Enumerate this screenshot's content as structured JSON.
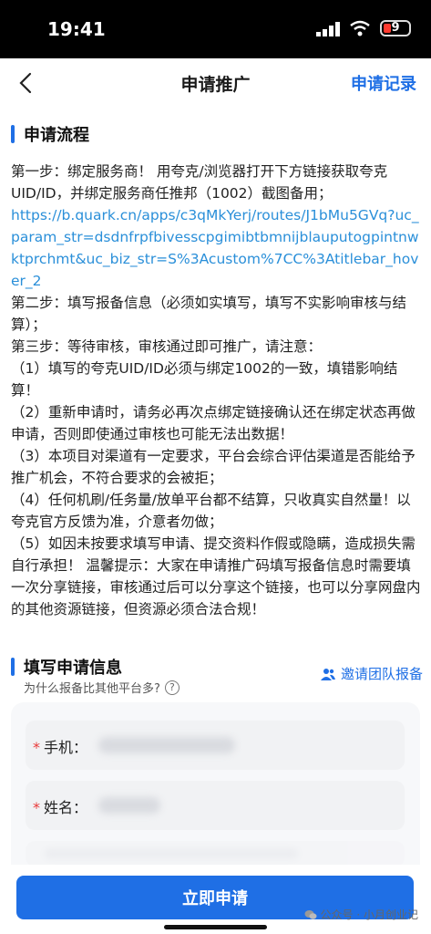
{
  "status": {
    "time": "19:41",
    "battery": "9",
    "colors": {
      "battery_low": "#ff3b30"
    }
  },
  "nav": {
    "title": "申请推广",
    "right_link": "申请记录"
  },
  "flow": {
    "heading": "申请流程",
    "step1": "第一步：绑定服务商！ 用夸克/浏览器打开下方链接获取夸克UID/ID，并绑定服务商任推邦（1002）截图备用；",
    "link": "https://b.quark.cn/apps/c3qMkYerj/routes/J1bMu5GVq?uc_param_str=dsdnfrpfbivesscpgimibtbmnijblauputogpintnwktprchmt&uc_biz_str=S%3Acustom%7CC%3Atitlebar_hover_2",
    "step2": "第二步：填写报备信息（必须如实填写，填写不实影响审核与结算）；",
    "step3": "第三步：等待审核，审核通过即可推广，请注意：",
    "notes": [
      "（1）填写的夸克UID/ID必须与绑定1002的一致，填错影响结算！",
      "（2）重新申请时，请务必再次点绑定链接确认还在绑定状态再做申请，否则即使通过审核也可能无法出数据！",
      "（3）本项目对渠道有一定要求，平台会综合评估渠道是否能给予推广机会，不符合要求的会被拒；",
      "（4）任何机刷/任务量/放单平台都不结算，只收真实自然量！以夸克官方反馈为准，介意者勿做；",
      "（5）如因未按要求填写申请、提交资料作假或隐瞒，造成损失需自行承担！ 温馨提示：大家在申请推广码填写报备信息时需要填一次分享链接，审核通过后可以分享这个链接，也可以分享网盘内的其他资源链接，但资源必须合法合规！"
    ]
  },
  "form": {
    "heading": "填写申请信息",
    "subtitle": "为什么报备比其他平台多?",
    "invite": "邀请团队报备",
    "fields": [
      {
        "label": "手机：",
        "required": "*"
      },
      {
        "label": "姓名：",
        "required": "*"
      }
    ]
  },
  "submit_label": "立即申请",
  "watermark": "公众号 · 小月创业记",
  "colors": {
    "accent": "#1f6fe5",
    "link": "#2a8fd9",
    "required": "#e83a3a"
  }
}
